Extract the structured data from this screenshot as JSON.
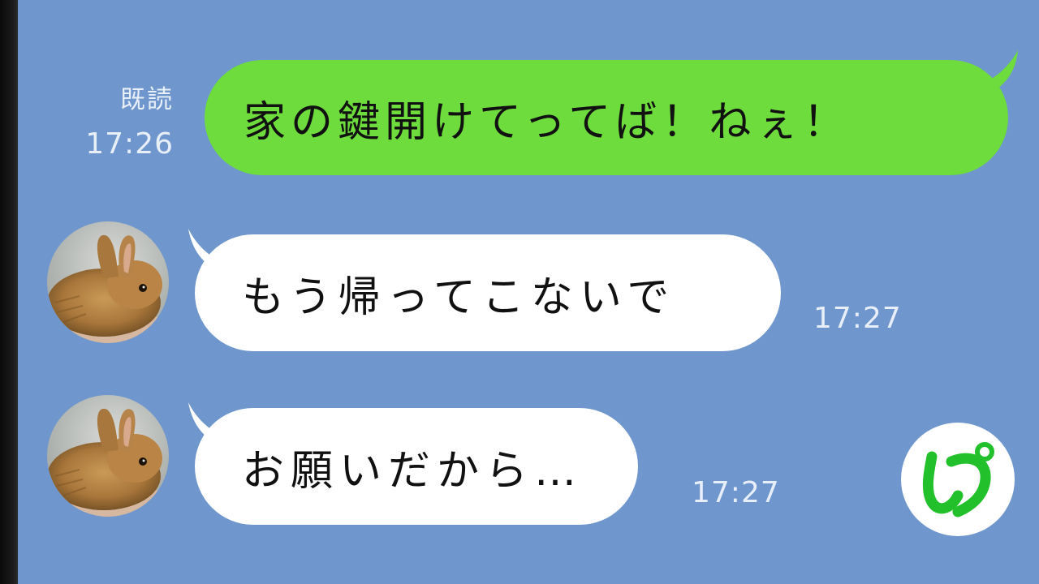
{
  "colors": {
    "chat_background": "#6f97cd",
    "sent_bubble": "#6ddc3c",
    "received_bubble": "#ffffff",
    "meta_text": "#e9eff8",
    "logo_accent": "#22c02a"
  },
  "messages": [
    {
      "direction": "sent",
      "text": "家の鍵開けてってば！ねぇ！",
      "read_label": "既読",
      "time": "17:26"
    },
    {
      "direction": "received",
      "text": "もう帰ってこないで",
      "time": "17:27",
      "avatar": "rabbit-avatar"
    },
    {
      "direction": "received",
      "text": "お願いだから…",
      "time": "17:27",
      "avatar": "rabbit-avatar"
    }
  ],
  "logo": {
    "glyph": "ぴ",
    "icon": "pi-logo-icon"
  }
}
